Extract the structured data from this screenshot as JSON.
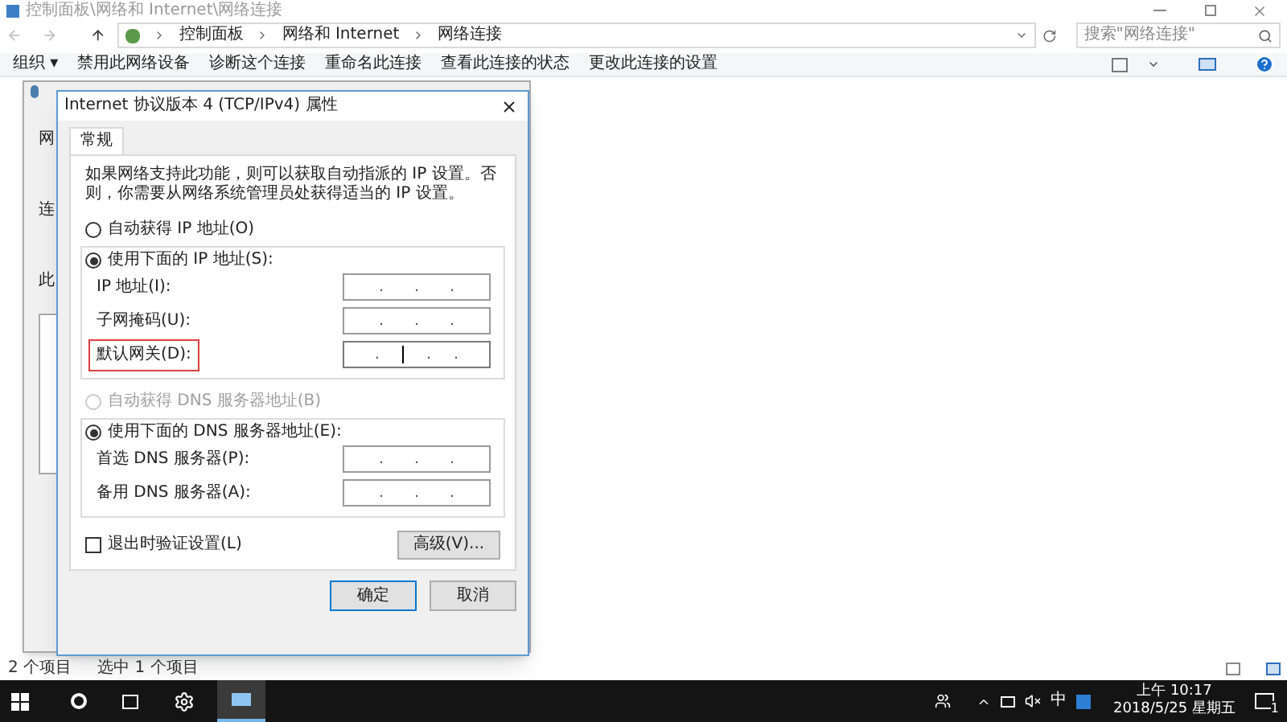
{
  "explorer": {
    "title": "控制面板\\网络和 Internet\\网络连接",
    "breadcrumb": [
      "控制面板",
      "网络和 Internet",
      "网络连接"
    ],
    "search": {
      "placeholder": "搜索\"网络连接\""
    },
    "toolbar": [
      {
        "label": "组织 ▾"
      },
      {
        "label": "禁用此网络设备"
      },
      {
        "label": "诊断这个连接"
      },
      {
        "label": "重命名此连接"
      },
      {
        "label": "查看此连接的状态"
      },
      {
        "label": "更改此连接的设置"
      }
    ],
    "status_bar": [
      "2 个项目",
      "选中 1 个项目"
    ]
  },
  "back_dialog": {
    "fragments": [
      "网",
      "连",
      "此"
    ]
  },
  "dialog": {
    "title": "Internet 协议版本 4 (TCP/IPv4) 属性",
    "tabs": [
      {
        "label": "常规",
        "selected": true
      }
    ],
    "description": "如果网络支持此功能，则可以获取自动指派的 IP 设置。否则，你需要从网络系统管理员处获得适当的 IP 设置。",
    "ip_mode": [
      {
        "label": "自动获得 IP 地址(O)",
        "selected": false,
        "disabled": false
      },
      {
        "label": "使用下面的 IP 地址(S):",
        "selected": true,
        "disabled": false
      }
    ],
    "ip_fields": [
      {
        "label": "IP 地址(I):",
        "separators": [
          ".",
          ".",
          "."
        ],
        "highlighted": false,
        "focused": false
      },
      {
        "label": "子网掩码(U):",
        "separators": [
          ".",
          ".",
          "."
        ],
        "highlighted": false,
        "focused": false
      },
      {
        "label": "默认网关(D):",
        "separators": [
          ".",
          ".",
          "."
        ],
        "highlighted": true,
        "focused": true
      }
    ],
    "dns_mode": [
      {
        "label": "自动获得 DNS 服务器地址(B)",
        "selected": false,
        "disabled": true
      },
      {
        "label": "使用下面的 DNS 服务器地址(E):",
        "selected": true,
        "disabled": false
      }
    ],
    "dns_fields": [
      {
        "label": "首选 DNS 服务器(P):",
        "separators": [
          ".",
          ".",
          "."
        ],
        "highlighted": false,
        "focused": false
      },
      {
        "label": "备用 DNS 服务器(A):",
        "separators": [
          ".",
          ".",
          "."
        ],
        "highlighted": false,
        "focused": false
      }
    ],
    "validate": {
      "label": "退出时验证设置(L)",
      "checked": false
    },
    "advanced_button": "高级(V)...",
    "buttons": [
      {
        "label": "确定",
        "selected": true
      },
      {
        "label": "取消",
        "selected": false
      }
    ]
  },
  "taskbar": {
    "ime": "中",
    "time": "上午 10:17",
    "date": "2018/5/25 星期五",
    "notifications": "1"
  }
}
